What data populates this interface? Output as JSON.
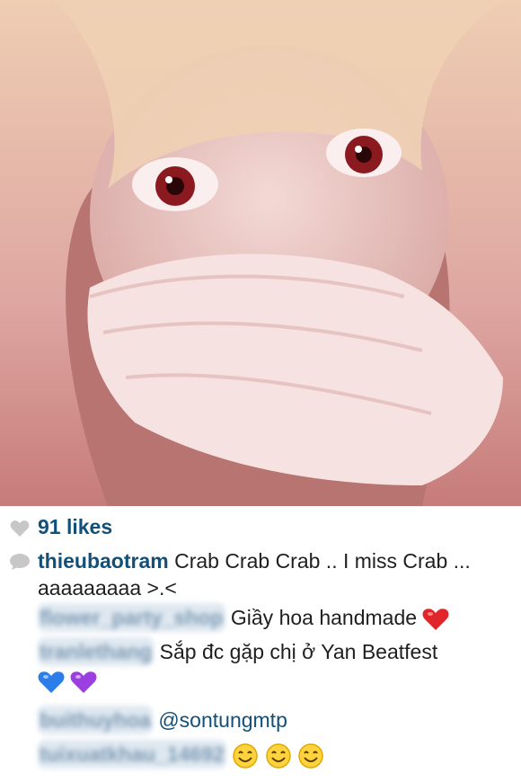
{
  "post": {
    "likes": "91 likes",
    "caption_user": "thieubaotram",
    "caption_text": "Crab Crab Crab .. I miss Crab ... aaaaaaaaa >.<"
  },
  "comments": [
    {
      "user": "flower_party_shop",
      "text": "Giầy hoa handmade",
      "emoji": "heart-red-emoji"
    },
    {
      "user": "tranlethang",
      "text": "Sắp đc gặp chị ở Yan Beatfest",
      "emoji": "heart-blue-purple-emoji"
    },
    {
      "user": "buithuyhoa",
      "mention": "@sontungmtp"
    },
    {
      "user": "tuixuatkhau_14692",
      "emoji": "smile-emoji-x3"
    }
  ],
  "colors": {
    "username_blue": "#12507a",
    "text": "#1f1f1f",
    "icon_gray": "#c7c7c7"
  }
}
